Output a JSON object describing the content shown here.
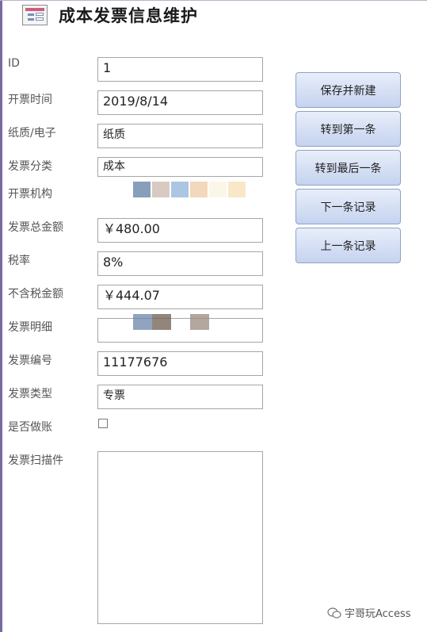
{
  "header": {
    "title": "成本发票信息维护",
    "icon": "form-icon"
  },
  "labels": {
    "id": "ID",
    "time": "开票时间",
    "media": "纸质/电子",
    "category": "发票分类",
    "issuer": "开票机构",
    "total": "发票总金额",
    "tax_rate": "税率",
    "net": "不含税金额",
    "detail": "发票明细",
    "number": "发票编号",
    "type": "发票类型",
    "posted": "是否做账",
    "scan": "发票扫描件"
  },
  "values": {
    "id": "1",
    "time": "2019/8/14",
    "media": "纸质",
    "category": "成本",
    "total": "￥480.00",
    "tax_rate": "8%",
    "net": "￥444.07",
    "number": "11177676",
    "type": "专票",
    "posted": false
  },
  "buttons": {
    "save_new": "保存并新建",
    "first": "转到第一条",
    "last": "转到最后一条",
    "next": "下一条记录",
    "prev": "上一条记录"
  },
  "watermark": {
    "text": "宇哥玩Access",
    "icon": "wechat-icon"
  },
  "colors": {
    "button_top": "#e8eefa",
    "button_bottom": "#c5d3ef",
    "border": "#a6a6a6"
  }
}
